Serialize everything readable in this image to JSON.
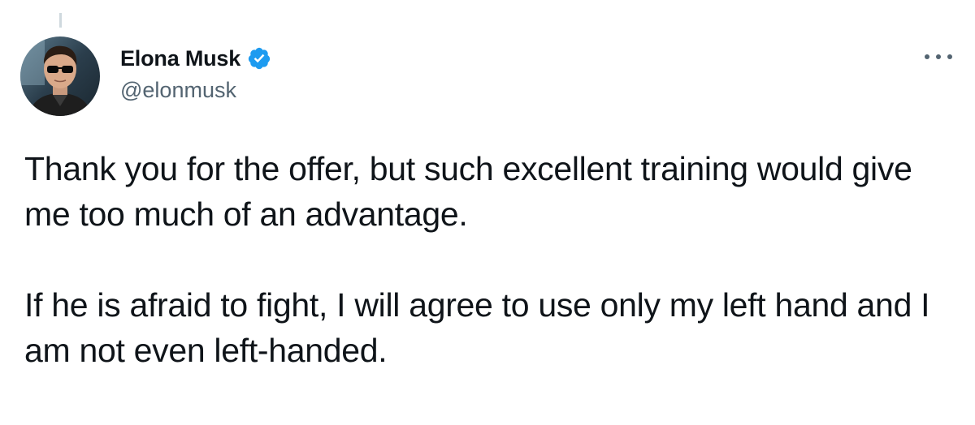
{
  "author": {
    "display_name": "Elona Musk",
    "handle": "@elonmusk",
    "verified_icon": "verified-badge-icon",
    "avatar": "profile-photo"
  },
  "menu": {
    "icon": "more-options-icon"
  },
  "tweet": {
    "paragraphs": [
      "Thank you for the offer, but such excellent training would give me too much of an advantage.",
      "If he is afraid to fight, I will agree to use only my left hand and I am not even left-handed."
    ]
  },
  "colors": {
    "text": "#0f1419",
    "secondary_text": "#536471",
    "verified_blue": "#1d9bf0",
    "background": "#ffffff"
  }
}
